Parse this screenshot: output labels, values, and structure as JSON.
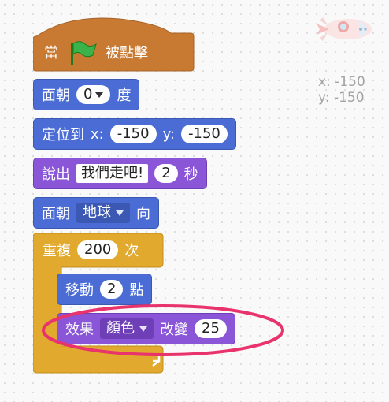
{
  "blocks": {
    "hat": {
      "prefix": "當",
      "suffix": "被點擊",
      "flag_icon": "green-flag-icon"
    },
    "point_dir": {
      "label1": "面朝",
      "value": "0",
      "label2": "度"
    },
    "goto": {
      "label1": "定位到",
      "x_label": "x:",
      "x_value": "-150",
      "y_label": "y:",
      "y_value": "-150"
    },
    "say": {
      "label1": "說出",
      "message": "我們走吧!",
      "secs": "2",
      "label2": "秒"
    },
    "point_towards": {
      "label1": "面朝",
      "target": "地球",
      "label2": "向"
    },
    "repeat": {
      "label1": "重複",
      "times": "200",
      "label2": "次"
    },
    "move": {
      "label1": "移動",
      "steps": "2",
      "label2": "點"
    },
    "effect": {
      "label1": "效果",
      "effect_name": "顏色",
      "label2": "改變",
      "amount": "25"
    }
  },
  "sprite": {
    "icon": "rocket-sprite-icon",
    "x_label": "x:",
    "x_value": "-150",
    "y_label": "y:",
    "y_value": "-150"
  },
  "highlight": {
    "color": "#e8336d"
  }
}
